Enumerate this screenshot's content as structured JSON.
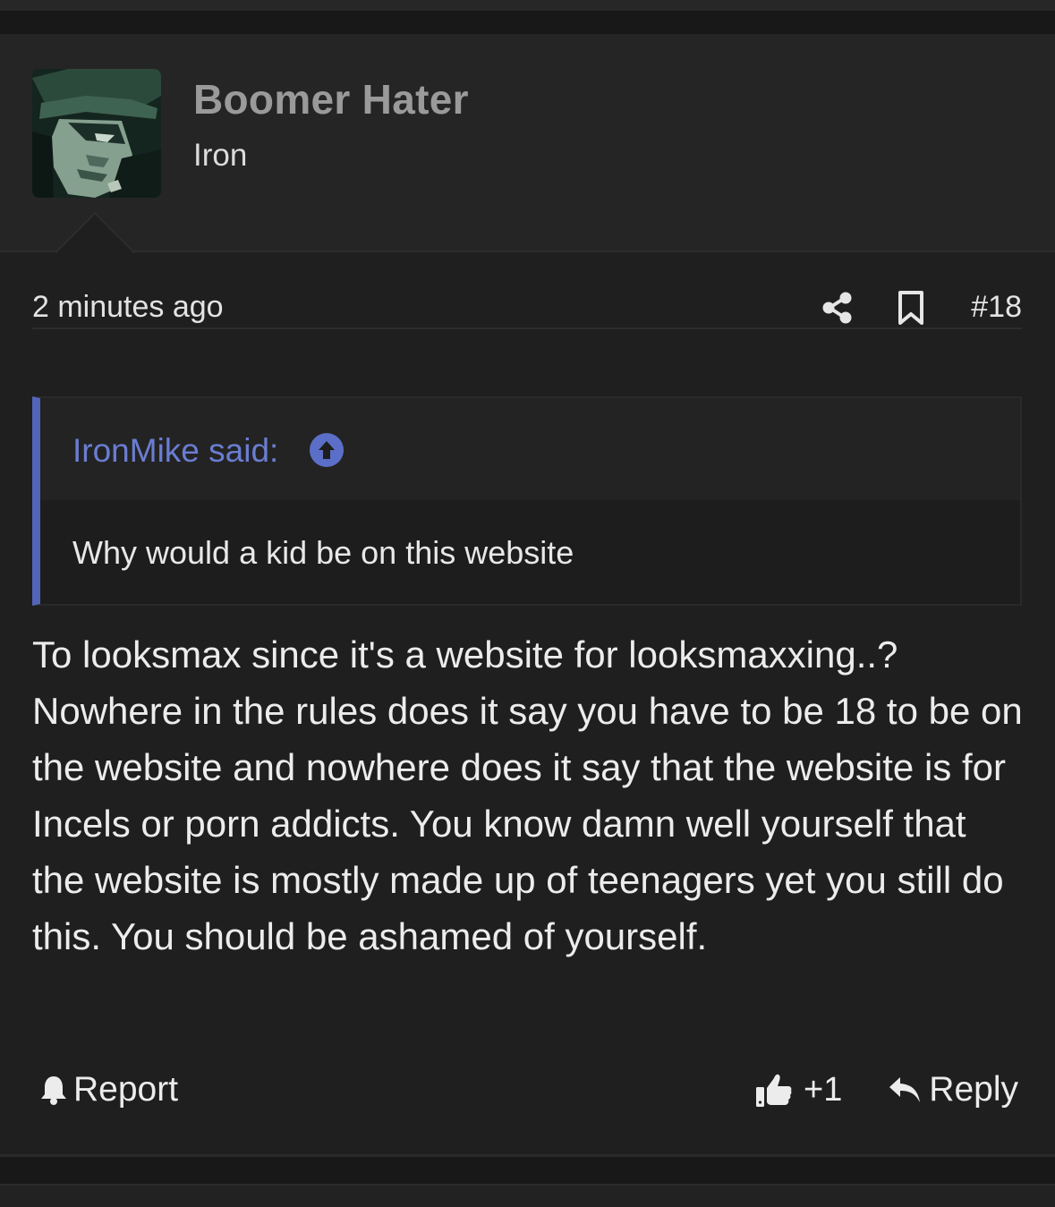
{
  "post": {
    "author": {
      "name": "Boomer Hater",
      "rank": "Iron",
      "avatar_icon": "anime-character-avatar"
    },
    "meta": {
      "time": "2 minutes ago",
      "number": "#18",
      "share_icon": "share-icon",
      "bookmark_icon": "bookmark-icon"
    },
    "quote": {
      "attribution": "IronMike said:",
      "text": "Why would a kid be on this website",
      "accent_color": "#5264b8"
    },
    "body": "To looksmax since it's a website for looksmaxxing..? Nowhere in the rules does it say you have to be 18 to be on the website and nowhere does it say that the website is for Incels or porn addicts. You know damn well yourself that the website is mostly made up of teenagers yet you still do this. You should be ashamed of yourself.",
    "actions": {
      "report_label": "Report",
      "like_label": "+1",
      "reply_label": "Reply"
    }
  }
}
